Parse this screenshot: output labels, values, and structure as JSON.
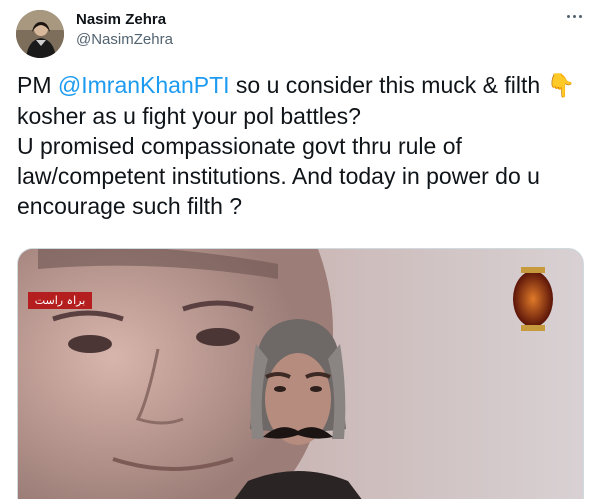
{
  "author": {
    "name": "Nasim Zehra",
    "handle": "@NasimZehra",
    "avatar_icon": "profile-photo"
  },
  "more_icon": "more-dots-icon",
  "tweet": {
    "prefix": "PM ",
    "mention": "@ImranKhanPTI",
    "line1_rest": " so u consider this muck & filth ",
    "emoji": "👇",
    "line2": "kosher as u fight your pol battles?",
    "line3": "U promised compassionate govt thru rule of",
    "line4": "law/competent institutions. And today in power do u",
    "line5": "encourage such filth ?"
  },
  "media": {
    "type": "video-thumbnail",
    "logo_text": "براہ راست"
  },
  "colors": {
    "mention": "#1d9bf0",
    "text": "#0f1419",
    "secondary": "#536471",
    "border": "#cfd9de"
  }
}
